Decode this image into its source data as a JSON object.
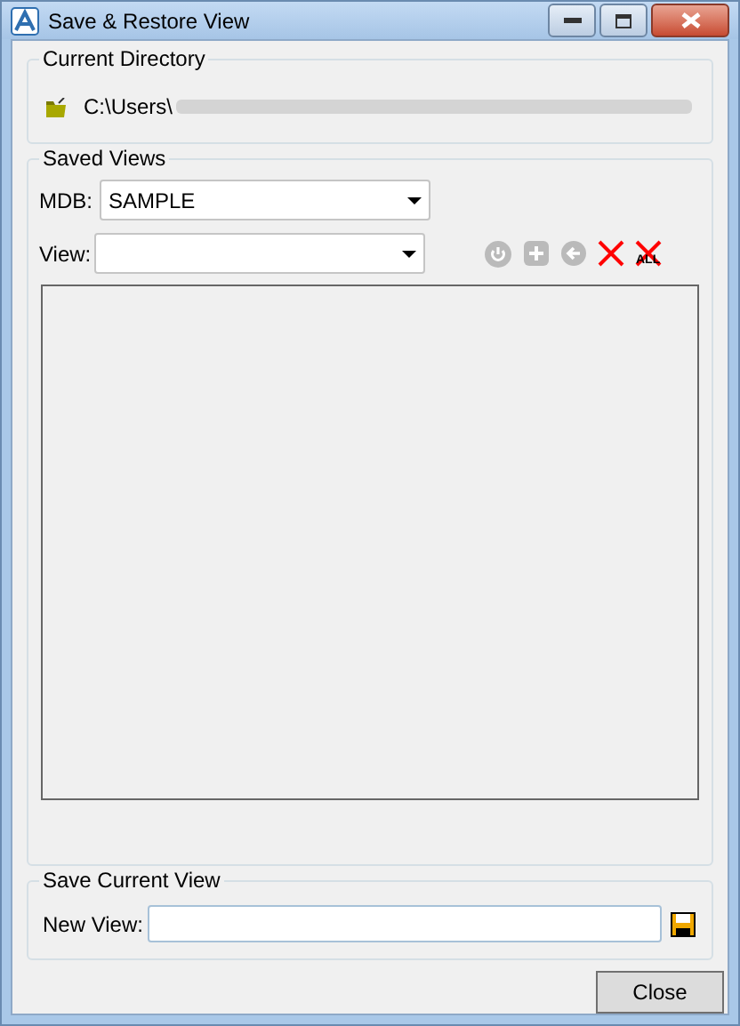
{
  "window": {
    "title": "Save & Restore View"
  },
  "current_directory": {
    "title": "Current Directory",
    "path": "C:\\Users\\"
  },
  "saved_views": {
    "title": "Saved Views",
    "mdb": {
      "label": "MDB:",
      "value": "SAMPLE"
    },
    "view": {
      "label": "View:"
    },
    "tools": [
      {
        "kind": "power",
        "disabled": true
      },
      {
        "kind": "add",
        "disabled": true
      },
      {
        "kind": "back",
        "disabled": true
      },
      {
        "kind": "delete",
        "disabled": false
      },
      {
        "kind": "delete_all",
        "disabled": false,
        "badge": "ALL"
      }
    ]
  },
  "save_current_view": {
    "title": "Save Current View",
    "label": "New View:"
  },
  "buttons": [
    {
      "label": "Close"
    }
  ]
}
